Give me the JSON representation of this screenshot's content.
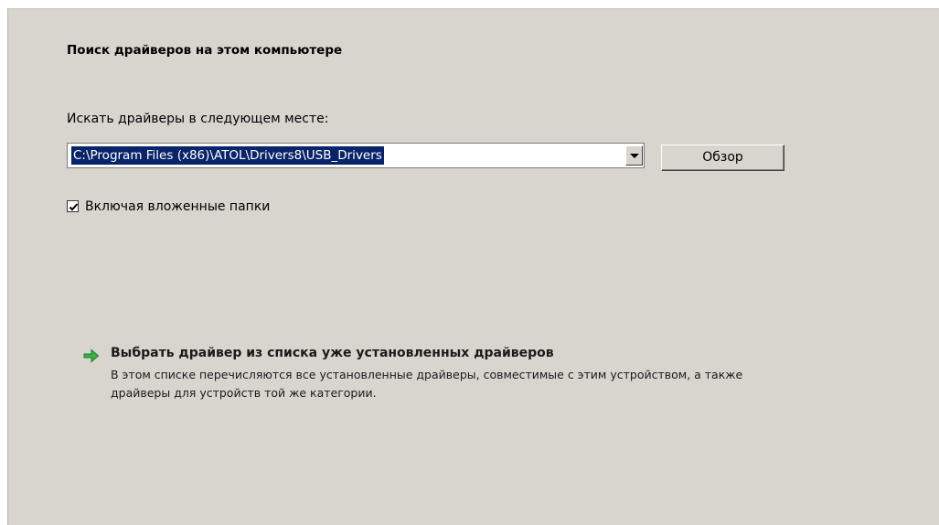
{
  "dialog": {
    "heading": "Поиск драйверов на этом компьютере",
    "search_label": "Искать драйверы в следующем месте:",
    "path_value": "C:\\Program Files (x86)\\ATOL\\Drivers8\\USB_Drivers",
    "browse_label": "Обзор",
    "include_subfolders": {
      "label": "Включая вложенные папки",
      "checked": true
    },
    "pick_from_list": {
      "icon": "green-arrow-icon",
      "title": "Выбрать драйвер из списка уже установленных драйверов",
      "description": "В этом списке перечисляются все установленные драйверы, совместимые с этим устройством, а также драйверы для устройств той же категории."
    }
  }
}
